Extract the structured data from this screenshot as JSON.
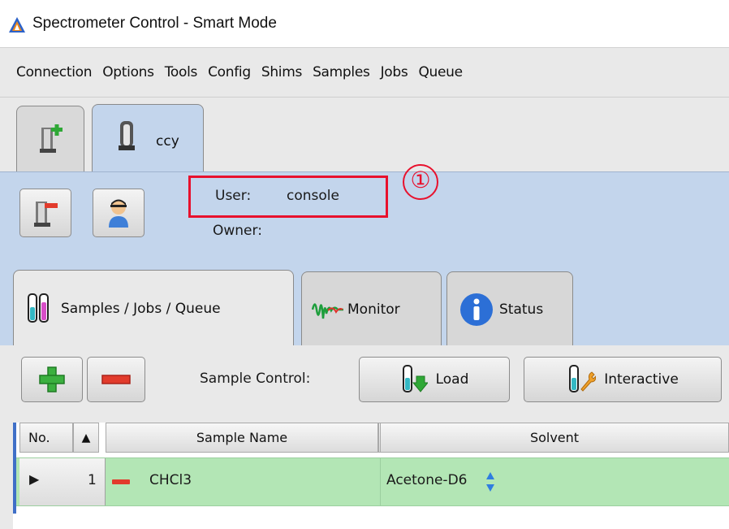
{
  "window": {
    "title": "Spectrometer Control - Smart Mode"
  },
  "menubar": {
    "items": [
      "Connection",
      "Options",
      "Tools",
      "Config",
      "Shims",
      "Samples",
      "Jobs",
      "Queue"
    ]
  },
  "spectrometer_tabs": {
    "active_label": "ccy"
  },
  "session": {
    "user_label": "User:",
    "user_value": "console",
    "owner_label": "Owner:",
    "annotation": "①"
  },
  "inner_tabs": [
    {
      "label": "Samples / Jobs / Queue"
    },
    {
      "label": "Monitor"
    },
    {
      "label": "Status"
    }
  ],
  "toolbar": {
    "sample_control_label": "Sample Control:",
    "load_label": "Load",
    "interactive_label": "Interactive"
  },
  "table": {
    "headers": {
      "no": "No.",
      "sort": "▲",
      "name": "Sample Name",
      "solvent": "Solvent"
    },
    "rows": [
      {
        "arrow": "▶",
        "no": "1",
        "name": "CHCl3",
        "solvent": "Acetone-D6"
      }
    ]
  },
  "colors": {
    "panel_blue": "#c3d5ec",
    "row_green": "#b3e6b5",
    "highlight_red": "#e8112d"
  }
}
